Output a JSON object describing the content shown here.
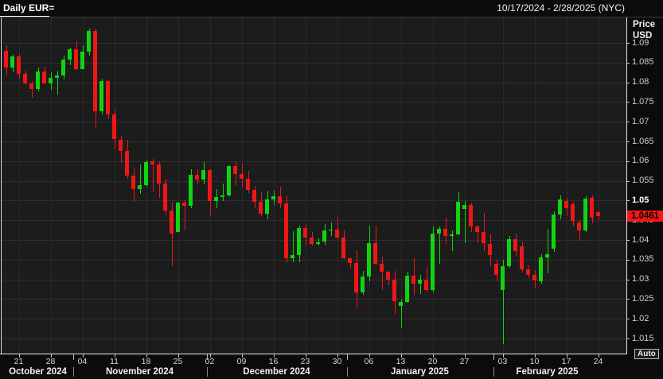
{
  "header": {
    "title": "Daily EUR=",
    "date_range": "10/17/2024 - 2/28/2025 (NYC)"
  },
  "y_axis": {
    "title_line1": "Price",
    "title_line2": "USD",
    "labels": [
      "1.09",
      "1.085",
      "1.08",
      "1.075",
      "1.07",
      "1.065",
      "1.06",
      "1.055",
      "1.05",
      "1.045",
      "1.04",
      "1.035",
      "1.03",
      "1.025",
      "1.02",
      "1.015"
    ],
    "bold_label": "1.05",
    "auto_label": "Auto"
  },
  "current_price": "1.0461",
  "colors": {
    "up": "#11d411",
    "down": "#ef1616",
    "price_box_bg": "#f51717",
    "price_box_text": "#000000",
    "plot_bg": "#1c1c1c",
    "grid": "#2e2e2e"
  },
  "x_axis": {
    "day_ticks": [
      {
        "idx": 2,
        "label": "21"
      },
      {
        "idx": 7,
        "label": "28"
      },
      {
        "idx": 12,
        "label": "04"
      },
      {
        "idx": 17,
        "label": "11"
      },
      {
        "idx": 22,
        "label": "18"
      },
      {
        "idx": 27,
        "label": "25"
      },
      {
        "idx": 32,
        "label": "02"
      },
      {
        "idx": 37,
        "label": "09"
      },
      {
        "idx": 42,
        "label": "16"
      },
      {
        "idx": 47,
        "label": "23"
      },
      {
        "idx": 52,
        "label": "30"
      },
      {
        "idx": 57,
        "label": "06"
      },
      {
        "idx": 62,
        "label": "13"
      },
      {
        "idx": 67,
        "label": "20"
      },
      {
        "idx": 72,
        "label": "27"
      },
      {
        "idx": 78,
        "label": "03"
      },
      {
        "idx": 83,
        "label": "10"
      },
      {
        "idx": 88,
        "label": "17"
      },
      {
        "idx": 93,
        "label": "24"
      }
    ],
    "months": [
      {
        "label": "October 2024",
        "start": 0,
        "end": 10
      },
      {
        "label": "November 2024",
        "start": 11,
        "end": 31
      },
      {
        "label": "December 2024",
        "start": 32,
        "end": 53
      },
      {
        "label": "January 2025",
        "start": 54,
        "end": 76
      },
      {
        "label": "February 2025",
        "start": 77,
        "end": 93
      }
    ]
  },
  "chart_data": {
    "type": "candlestick",
    "title": "Daily EUR=",
    "instrument": "EUR=",
    "interval": "Daily",
    "ylabel": "Price USD",
    "ylim": [
      1.011,
      1.0962
    ],
    "grid": true,
    "price_levels": [
      1.09,
      1.085,
      1.08,
      1.075,
      1.07,
      1.065,
      1.06,
      1.055,
      1.05,
      1.045,
      1.04,
      1.035,
      1.03,
      1.025,
      1.02,
      1.015
    ],
    "last_price": 1.0461,
    "candles": [
      {
        "d": "10/17",
        "o": 1.088,
        "h": 1.0894,
        "l": 1.0817,
        "c": 1.0838
      },
      {
        "d": "10/18",
        "o": 1.0838,
        "h": 1.087,
        "l": 1.0826,
        "c": 1.0866
      },
      {
        "d": "10/21",
        "o": 1.0866,
        "h": 1.0872,
        "l": 1.081,
        "c": 1.0821
      },
      {
        "d": "10/22",
        "o": 1.0821,
        "h": 1.083,
        "l": 1.0794,
        "c": 1.0798
      },
      {
        "d": "10/23",
        "o": 1.0798,
        "h": 1.0804,
        "l": 1.0761,
        "c": 1.0782
      },
      {
        "d": "10/24",
        "o": 1.0782,
        "h": 1.0838,
        "l": 1.0777,
        "c": 1.0827
      },
      {
        "d": "10/25",
        "o": 1.0827,
        "h": 1.0839,
        "l": 1.0796,
        "c": 1.0797
      },
      {
        "d": "10/28",
        "o": 1.0797,
        "h": 1.0826,
        "l": 1.078,
        "c": 1.0812
      },
      {
        "d": "10/29",
        "o": 1.0812,
        "h": 1.083,
        "l": 1.0768,
        "c": 1.0818
      },
      {
        "d": "10/30",
        "o": 1.0818,
        "h": 1.0868,
        "l": 1.0808,
        "c": 1.0857
      },
      {
        "d": "10/31",
        "o": 1.0857,
        "h": 1.0888,
        "l": 1.0844,
        "c": 1.0883
      },
      {
        "d": "11/01",
        "o": 1.0883,
        "h": 1.0905,
        "l": 1.0832,
        "c": 1.0834
      },
      {
        "d": "11/04",
        "o": 1.0834,
        "h": 1.0895,
        "l": 1.0834,
        "c": 1.0877
      },
      {
        "d": "11/05",
        "o": 1.0877,
        "h": 1.0937,
        "l": 1.0868,
        "c": 1.0931
      },
      {
        "d": "11/06",
        "o": 1.0931,
        "h": 1.0937,
        "l": 1.0683,
        "c": 1.0727
      },
      {
        "d": "11/07",
        "o": 1.0727,
        "h": 1.081,
        "l": 1.0719,
        "c": 1.0804
      },
      {
        "d": "11/08",
        "o": 1.0804,
        "h": 1.0808,
        "l": 1.0707,
        "c": 1.0718
      },
      {
        "d": "11/11",
        "o": 1.0718,
        "h": 1.073,
        "l": 1.0629,
        "c": 1.0655
      },
      {
        "d": "11/12",
        "o": 1.0655,
        "h": 1.0665,
        "l": 1.0595,
        "c": 1.0625
      },
      {
        "d": "11/13",
        "o": 1.0625,
        "h": 1.0655,
        "l": 1.0555,
        "c": 1.0563
      },
      {
        "d": "11/14",
        "o": 1.0563,
        "h": 1.0583,
        "l": 1.0497,
        "c": 1.053
      },
      {
        "d": "11/15",
        "o": 1.053,
        "h": 1.0592,
        "l": 1.0516,
        "c": 1.054
      },
      {
        "d": "11/18",
        "o": 1.054,
        "h": 1.0603,
        "l": 1.0535,
        "c": 1.0597
      },
      {
        "d": "11/19",
        "o": 1.06,
        "h": 1.0605,
        "l": 1.0522,
        "c": 1.0592
      },
      {
        "d": "11/20",
        "o": 1.0592,
        "h": 1.0599,
        "l": 1.0507,
        "c": 1.0543
      },
      {
        "d": "11/21",
        "o": 1.0543,
        "h": 1.0555,
        "l": 1.0462,
        "c": 1.0474
      },
      {
        "d": "11/22",
        "o": 1.0474,
        "h": 1.0497,
        "l": 1.0333,
        "c": 1.0417
      },
      {
        "d": "11/25",
        "o": 1.0421,
        "h": 1.0497,
        "l": 1.0421,
        "c": 1.0495
      },
      {
        "d": "11/26",
        "o": 1.0495,
        "h": 1.05,
        "l": 1.0425,
        "c": 1.0486
      },
      {
        "d": "11/27",
        "o": 1.0486,
        "h": 1.058,
        "l": 1.048,
        "c": 1.0566
      },
      {
        "d": "11/28",
        "o": 1.0566,
        "h": 1.058,
        "l": 1.054,
        "c": 1.0553
      },
      {
        "d": "11/29",
        "o": 1.0553,
        "h": 1.0598,
        "l": 1.0542,
        "c": 1.0577
      },
      {
        "d": "12/02",
        "o": 1.0577,
        "h": 1.058,
        "l": 1.0461,
        "c": 1.0498
      },
      {
        "d": "12/03",
        "o": 1.0498,
        "h": 1.053,
        "l": 1.048,
        "c": 1.0509
      },
      {
        "d": "12/04",
        "o": 1.0509,
        "h": 1.0544,
        "l": 1.0499,
        "c": 1.0512
      },
      {
        "d": "12/05",
        "o": 1.0512,
        "h": 1.059,
        "l": 1.051,
        "c": 1.0588
      },
      {
        "d": "12/06",
        "o": 1.0588,
        "h": 1.0597,
        "l": 1.0538,
        "c": 1.0568
      },
      {
        "d": "12/09",
        "o": 1.0568,
        "h": 1.0595,
        "l": 1.0533,
        "c": 1.0555
      },
      {
        "d": "12/10",
        "o": 1.0555,
        "h": 1.0576,
        "l": 1.0518,
        "c": 1.0527
      },
      {
        "d": "12/11",
        "o": 1.0527,
        "h": 1.0537,
        "l": 1.048,
        "c": 1.0496
      },
      {
        "d": "12/12",
        "o": 1.0496,
        "h": 1.0522,
        "l": 1.0461,
        "c": 1.0467
      },
      {
        "d": "12/13",
        "o": 1.0467,
        "h": 1.0525,
        "l": 1.0453,
        "c": 1.0502
      },
      {
        "d": "12/16",
        "o": 1.0502,
        "h": 1.0525,
        "l": 1.0489,
        "c": 1.0511
      },
      {
        "d": "12/17",
        "o": 1.0511,
        "h": 1.0535,
        "l": 1.048,
        "c": 1.0493
      },
      {
        "d": "12/18",
        "o": 1.0493,
        "h": 1.0512,
        "l": 1.0344,
        "c": 1.0353
      },
      {
        "d": "12/19",
        "o": 1.0353,
        "h": 1.0422,
        "l": 1.0343,
        "c": 1.0362
      },
      {
        "d": "12/20",
        "o": 1.0362,
        "h": 1.0437,
        "l": 1.0343,
        "c": 1.043
      },
      {
        "d": "12/23",
        "o": 1.043,
        "h": 1.044,
        "l": 1.0385,
        "c": 1.0406
      },
      {
        "d": "12/24",
        "o": 1.0406,
        "h": 1.042,
        "l": 1.0385,
        "c": 1.039
      },
      {
        "d": "12/25",
        "o": 1.039,
        "h": 1.0404,
        "l": 1.0386,
        "c": 1.0395
      },
      {
        "d": "12/26",
        "o": 1.0395,
        "h": 1.044,
        "l": 1.0388,
        "c": 1.0424
      },
      {
        "d": "12/27",
        "o": 1.0424,
        "h": 1.0445,
        "l": 1.0411,
        "c": 1.0427
      },
      {
        "d": "12/30",
        "o": 1.0427,
        "h": 1.0458,
        "l": 1.0399,
        "c": 1.0406
      },
      {
        "d": "12/31",
        "o": 1.0406,
        "h": 1.0425,
        "l": 1.0352,
        "c": 1.0354
      },
      {
        "d": "01/01",
        "o": 1.0354,
        "h": 1.0356,
        "l": 1.0328,
        "c": 1.0341
      },
      {
        "d": "01/02",
        "o": 1.0341,
        "h": 1.0374,
        "l": 1.0226,
        "c": 1.0266
      },
      {
        "d": "01/03",
        "o": 1.0266,
        "h": 1.0322,
        "l": 1.026,
        "c": 1.0308
      },
      {
        "d": "01/06",
        "o": 1.0308,
        "h": 1.0437,
        "l": 1.0294,
        "c": 1.0393
      },
      {
        "d": "01/07",
        "o": 1.0393,
        "h": 1.0437,
        "l": 1.0336,
        "c": 1.034
      },
      {
        "d": "01/08",
        "o": 1.034,
        "h": 1.0358,
        "l": 1.0273,
        "c": 1.0319
      },
      {
        "d": "01/09",
        "o": 1.0319,
        "h": 1.0321,
        "l": 1.0285,
        "c": 1.03
      },
      {
        "d": "01/10",
        "o": 1.03,
        "h": 1.0321,
        "l": 1.0213,
        "c": 1.0244
      },
      {
        "d": "01/13",
        "o": 1.0233,
        "h": 1.0248,
        "l": 1.0177,
        "c": 1.0243
      },
      {
        "d": "01/14",
        "o": 1.0243,
        "h": 1.032,
        "l": 1.024,
        "c": 1.0309
      },
      {
        "d": "01/15",
        "o": 1.0309,
        "h": 1.0354,
        "l": 1.026,
        "c": 1.0289
      },
      {
        "d": "01/16",
        "o": 1.0289,
        "h": 1.0312,
        "l": 1.0262,
        "c": 1.03
      },
      {
        "d": "01/17",
        "o": 1.03,
        "h": 1.0332,
        "l": 1.0266,
        "c": 1.0272
      },
      {
        "d": "01/20",
        "o": 1.0272,
        "h": 1.0434,
        "l": 1.0266,
        "c": 1.0417
      },
      {
        "d": "01/21",
        "o": 1.0417,
        "h": 1.0435,
        "l": 1.034,
        "c": 1.0428
      },
      {
        "d": "01/22",
        "o": 1.0428,
        "h": 1.0457,
        "l": 1.039,
        "c": 1.041
      },
      {
        "d": "01/23",
        "o": 1.041,
        "h": 1.0425,
        "l": 1.0372,
        "c": 1.0415
      },
      {
        "d": "01/24",
        "o": 1.0415,
        "h": 1.0521,
        "l": 1.0412,
        "c": 1.0497
      },
      {
        "d": "01/27",
        "o": 1.0478,
        "h": 1.0499,
        "l": 1.0392,
        "c": 1.0489
      },
      {
        "d": "01/28",
        "o": 1.0489,
        "h": 1.0495,
        "l": 1.042,
        "c": 1.0435
      },
      {
        "d": "01/29",
        "o": 1.0435,
        "h": 1.0437,
        "l": 1.0392,
        "c": 1.042
      },
      {
        "d": "01/30",
        "o": 1.042,
        "h": 1.0468,
        "l": 1.0371,
        "c": 1.0391
      },
      {
        "d": "01/31",
        "o": 1.0391,
        "h": 1.0415,
        "l": 1.0333,
        "c": 1.0362
      },
      {
        "d": "02/02",
        "o": 1.034,
        "h": 1.035,
        "l": 1.0296,
        "c": 1.0312
      },
      {
        "d": "02/03",
        "o": 1.0273,
        "h": 1.035,
        "l": 1.0136,
        "c": 1.0334
      },
      {
        "d": "02/04",
        "o": 1.0334,
        "h": 1.041,
        "l": 1.033,
        "c": 1.0403
      },
      {
        "d": "02/05",
        "o": 1.0403,
        "h": 1.0414,
        "l": 1.0358,
        "c": 1.0372
      },
      {
        "d": "02/06",
        "o": 1.0383,
        "h": 1.0396,
        "l": 1.0318,
        "c": 1.0326
      },
      {
        "d": "02/07",
        "o": 1.0326,
        "h": 1.0336,
        "l": 1.0303,
        "c": 1.0311
      },
      {
        "d": "02/10",
        "o": 1.0311,
        "h": 1.0324,
        "l": 1.0277,
        "c": 1.0296
      },
      {
        "d": "02/11",
        "o": 1.0296,
        "h": 1.0364,
        "l": 1.029,
        "c": 1.0356
      },
      {
        "d": "02/12",
        "o": 1.0356,
        "h": 1.0428,
        "l": 1.0316,
        "c": 1.0364
      },
      {
        "d": "02/13",
        "o": 1.0378,
        "h": 1.0472,
        "l": 1.037,
        "c": 1.0465
      },
      {
        "d": "02/14",
        "o": 1.0465,
        "h": 1.0514,
        "l": 1.0452,
        "c": 1.0503
      },
      {
        "d": "02/17",
        "o": 1.0499,
        "h": 1.0507,
        "l": 1.0463,
        "c": 1.0481
      },
      {
        "d": "02/18",
        "o": 1.0491,
        "h": 1.0497,
        "l": 1.0435,
        "c": 1.0448
      },
      {
        "d": "02/19",
        "o": 1.0444,
        "h": 1.045,
        "l": 1.0398,
        "c": 1.0424
      },
      {
        "d": "02/20",
        "o": 1.0424,
        "h": 1.051,
        "l": 1.042,
        "c": 1.0505
      },
      {
        "d": "02/21",
        "o": 1.0507,
        "h": 1.0512,
        "l": 1.0443,
        "c": 1.0457
      },
      {
        "d": "02/24",
        "o": 1.047,
        "h": 1.0475,
        "l": 1.045,
        "c": 1.0461
      }
    ]
  }
}
